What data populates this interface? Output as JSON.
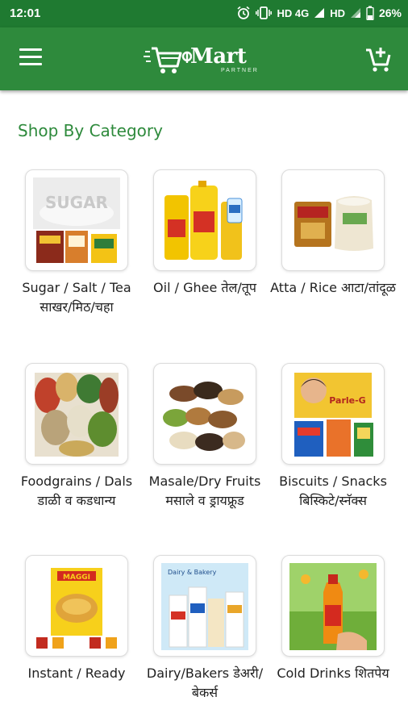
{
  "status_bar": {
    "time": "12:01",
    "network_1": "HD 4G",
    "network_2": "HD",
    "battery": "26%",
    "icons": [
      "alarm-icon",
      "vibrate-icon",
      "signal-icon",
      "battery-icon"
    ]
  },
  "app_bar": {
    "logo_text": "Mart",
    "logo_subtext": "PARTNER",
    "menu_icon": "menu-icon",
    "cart_icon": "add-to-cart-icon",
    "color": "#2e8a3c"
  },
  "section": {
    "title": "Shop By Category"
  },
  "categories": [
    {
      "label": "Sugar / Salt / Tea साखर/मिठ/चहा",
      "image": "sugar-salt-tea-image"
    },
    {
      "label": "Oil / Ghee तेल/तूप",
      "image": "oil-ghee-image"
    },
    {
      "label": "Atta / Rice आटा/तांदूळ",
      "image": "atta-rice-image"
    },
    {
      "label": "Foodgrains / Dals डाळी व कडधान्य",
      "image": "foodgrains-dals-image"
    },
    {
      "label": "Masale/Dry Fruits मसाले व ड्रायफ्रूड",
      "image": "masale-dry-fruits-image"
    },
    {
      "label": "Biscuits / Snacks बिस्किटे/स्नॅक्स",
      "image": "biscuits-snacks-image"
    },
    {
      "label": "Instant / Ready",
      "image": "instant-ready-image"
    },
    {
      "label": "Dairy/Bakers डेअरी/बेकर्स",
      "image": "dairy-bakery-image"
    },
    {
      "label": "Cold Drinks शितपेय",
      "image": "cold-drinks-image"
    }
  ],
  "image_text": {
    "sugar": "SUGAR",
    "parle": "Parle-G",
    "maggi": "MAGGI",
    "dairy": "Dairy & Bakery"
  }
}
